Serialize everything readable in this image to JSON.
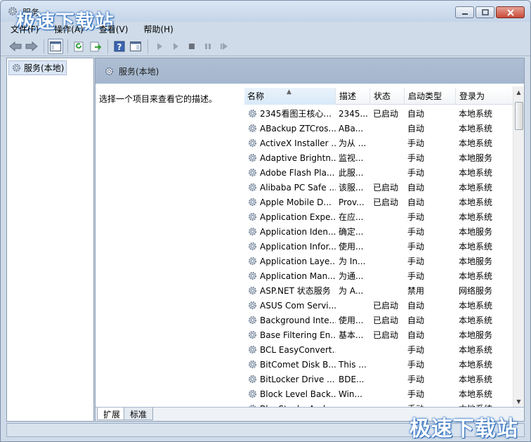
{
  "window": {
    "title": "服务"
  },
  "watermark": "极速下载站",
  "menu": [
    "文件(F)",
    "操作(A)",
    "查看(V)",
    "帮助(H)"
  ],
  "toolbar": {
    "icons": [
      "back-icon",
      "forward-icon",
      "show-hide-console-tree-icon",
      "refresh-icon",
      "export-list-icon",
      "help-icon",
      "properties-icon",
      "start-service-icon",
      "start-service-alt-icon",
      "stop-service-icon",
      "pause-service-icon",
      "restart-service-icon"
    ]
  },
  "tree": {
    "root_label": "服务(本地)"
  },
  "content": {
    "header": "服务(本地)",
    "description": "选择一个项目来查看它的描述。"
  },
  "list": {
    "columns": [
      "名称",
      "描述",
      "状态",
      "启动类型",
      "登录为"
    ],
    "rows": [
      {
        "name": "2345看图王核心...",
        "desc": "2345...",
        "status": "已启动",
        "start": "自动",
        "logon": "本地系统"
      },
      {
        "name": "ABackup ZTCros...",
        "desc": "ABa...",
        "status": "",
        "start": "自动",
        "logon": "本地系统"
      },
      {
        "name": "ActiveX Installer ...",
        "desc": "为从 ...",
        "status": "",
        "start": "手动",
        "logon": "本地系统"
      },
      {
        "name": "Adaptive Brightn...",
        "desc": "监视...",
        "status": "",
        "start": "手动",
        "logon": "本地服务"
      },
      {
        "name": "Adobe Flash Pla...",
        "desc": "此服...",
        "status": "",
        "start": "手动",
        "logon": "本地系统"
      },
      {
        "name": "Alibaba PC Safe ...",
        "desc": "该服...",
        "status": "已启动",
        "start": "自动",
        "logon": "本地系统"
      },
      {
        "name": "Apple Mobile D...",
        "desc": "Prov...",
        "status": "已启动",
        "start": "自动",
        "logon": "本地系统"
      },
      {
        "name": "Application Expe...",
        "desc": "在应...",
        "status": "",
        "start": "手动",
        "logon": "本地系统"
      },
      {
        "name": "Application Iden...",
        "desc": "确定...",
        "status": "",
        "start": "手动",
        "logon": "本地服务"
      },
      {
        "name": "Application Infor...",
        "desc": "使用...",
        "status": "",
        "start": "手动",
        "logon": "本地系统"
      },
      {
        "name": "Application Laye...",
        "desc": "为 In...",
        "status": "",
        "start": "手动",
        "logon": "本地服务"
      },
      {
        "name": "Application Man...",
        "desc": "为通...",
        "status": "",
        "start": "手动",
        "logon": "本地系统"
      },
      {
        "name": "ASP.NET 状态服务",
        "desc": "为 A...",
        "status": "",
        "start": "禁用",
        "logon": "网络服务"
      },
      {
        "name": "ASUS Com Servi...",
        "desc": "",
        "status": "已启动",
        "start": "自动",
        "logon": "本地系统"
      },
      {
        "name": "Background Inte...",
        "desc": "使用...",
        "status": "已启动",
        "start": "自动",
        "logon": "本地系统"
      },
      {
        "name": "Base Filtering En...",
        "desc": "基本...",
        "status": "已启动",
        "start": "自动",
        "logon": "本地服务"
      },
      {
        "name": "BCL EasyConvert...",
        "desc": "",
        "status": "",
        "start": "手动",
        "logon": "本地系统"
      },
      {
        "name": "BitComet Disk B...",
        "desc": "This ...",
        "status": "",
        "start": "手动",
        "logon": "本地系统"
      },
      {
        "name": "BitLocker Drive ...",
        "desc": "BDE...",
        "status": "",
        "start": "手动",
        "logon": "本地系统"
      },
      {
        "name": "Block Level Back...",
        "desc": "Win...",
        "status": "",
        "start": "手动",
        "logon": "本地系统"
      },
      {
        "name": "BlueStacks And...",
        "desc": "",
        "status": "",
        "start": "手动",
        "logon": "本地系统"
      }
    ]
  },
  "tabs": [
    "扩展",
    "标准"
  ]
}
